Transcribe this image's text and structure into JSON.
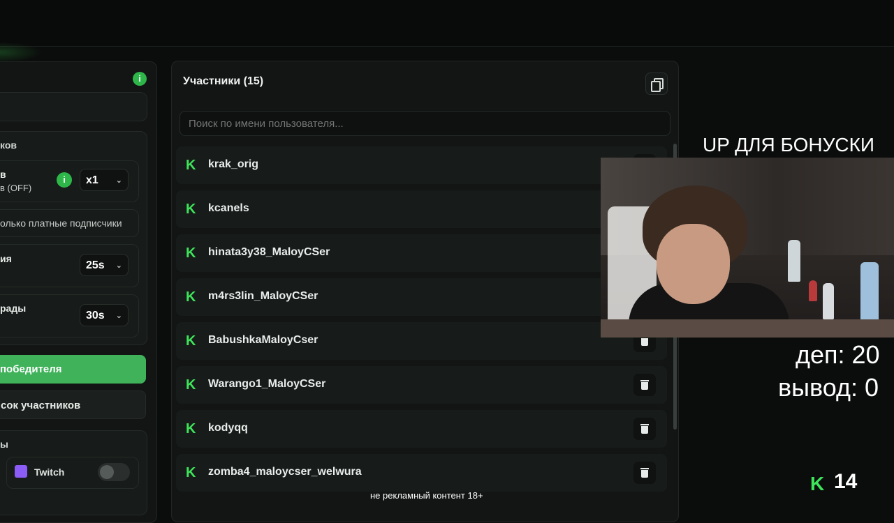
{
  "settings_panel": {
    "section_title": "ков",
    "multiplier_label": "в",
    "multiplier_sub": "в (OFF)",
    "multiplier_value": "x1",
    "paid_only_label": "олько платные подписчики",
    "timer1_label": "ия",
    "timer1_value": "25s",
    "timer2_label": "рады",
    "timer2_value": "30s",
    "pick_winner_label": "победителя",
    "list_label": "сок участников",
    "platforms_label": "ы",
    "twitch_label": "Twitch",
    "twitch_enabled": false
  },
  "participants": {
    "title": "Участники (15)",
    "search_placeholder": "Поиск по имени пользователя...",
    "items": [
      {
        "name": "krak_orig"
      },
      {
        "name": "kcanels"
      },
      {
        "name": "hinata3y38_MaloyCSer"
      },
      {
        "name": "m4rs3lin_MaloyCSer"
      },
      {
        "name": "BabushkaMaloyCser"
      },
      {
        "name": "Warango1_MaloyCSer"
      },
      {
        "name": "kodyqq"
      },
      {
        "name": "zomba4_maloycser_welwura"
      }
    ]
  },
  "stream_overlay": {
    "banner": "UP ДЛЯ БОНУСКИ",
    "dep": "деп: 20",
    "withdraw": "вывод: 0",
    "caption": "не рекламный контент 18+",
    "viewer_count": "14",
    "kick_logo": "K"
  },
  "colors": {
    "accent_green": "#3ee45a",
    "button_green": "#3fb25a",
    "panel_bg": "#121514"
  },
  "icons": {
    "platform_icon": "kick-logo-icon",
    "delete_icon": "trash-icon",
    "copy_icon": "copy-icon",
    "info_icon": "info-icon"
  }
}
